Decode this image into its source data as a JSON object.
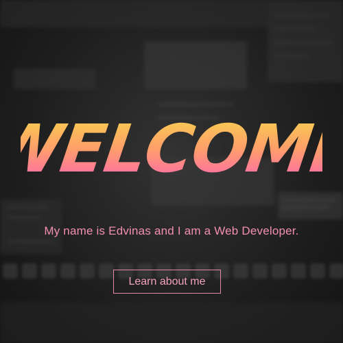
{
  "hero": {
    "title": "WELCOME",
    "subtitle": "My name is Edvinas and I am a Web Developer.",
    "cta_label": "Learn about me"
  },
  "colors": {
    "title_gradient_top": "#f7d84b",
    "title_gradient_mid": "#ff9f6a",
    "title_gradient_bottom": "#ff5fb8",
    "subtitle": "#f28fb0",
    "button_border": "#e889a8",
    "button_text": "#f4a3bd"
  }
}
